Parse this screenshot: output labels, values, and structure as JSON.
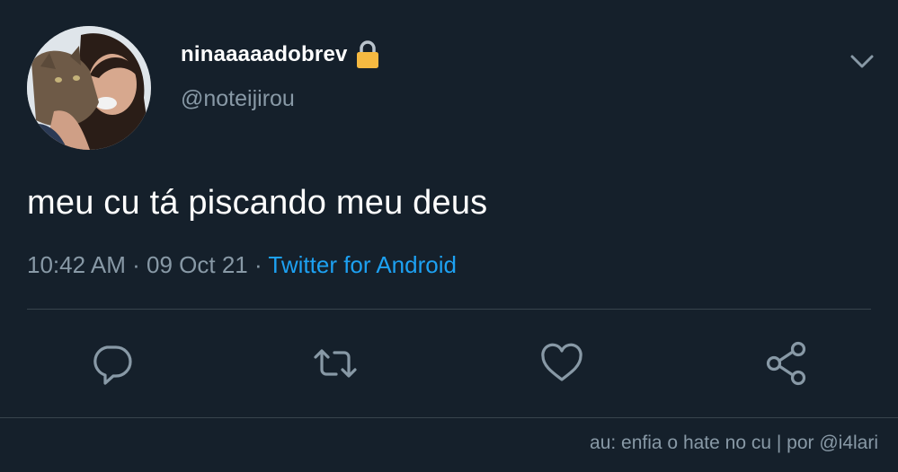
{
  "user": {
    "display_name": "ninaaaaadobrev",
    "handle": "@noteijirou",
    "protected_icon": "lock-icon",
    "avatar": "profile-photo"
  },
  "tweet": {
    "text": "meu cu tá piscando meu deus",
    "time": "10:42 AM",
    "separator": "·",
    "date": "09 Oct 21",
    "source": "Twitter for Android"
  },
  "actions": [
    {
      "icon": "reply-icon"
    },
    {
      "icon": "retweet-icon"
    },
    {
      "icon": "like-icon"
    },
    {
      "icon": "share-icon"
    }
  ],
  "menu_icon": "chevron-down-icon",
  "credit": "au: enfia o hate no cu | por @i4lari",
  "colors": {
    "background": "#15202b",
    "secondary_text": "#8899a6",
    "link": "#1da1f2",
    "divider": "#38444d",
    "lock": "#f5b941"
  }
}
